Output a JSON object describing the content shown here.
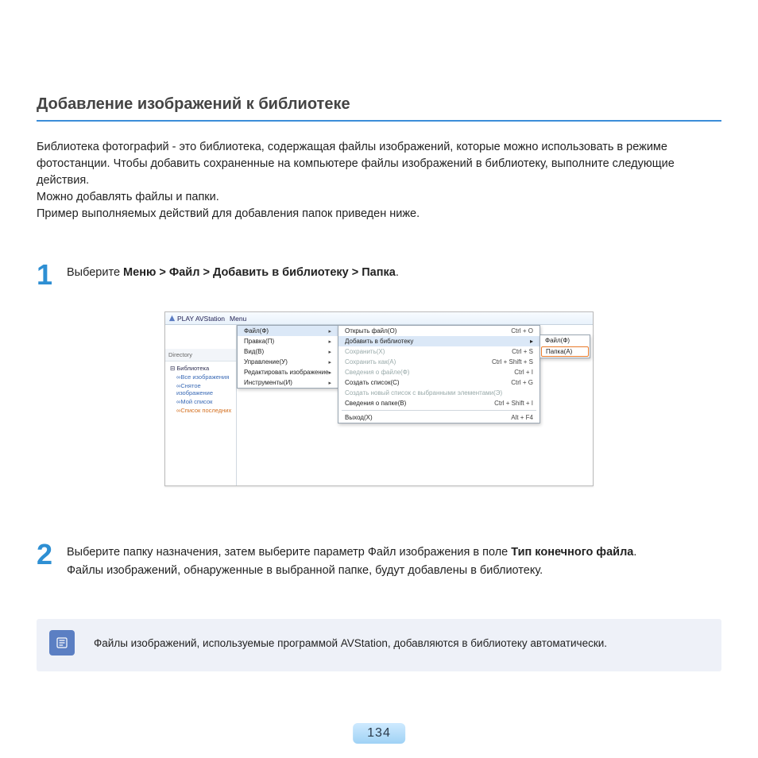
{
  "heading": "Добавление изображений к библиотеке",
  "intro": [
    "Библиотека фотографий - это библиотека, содержащая файлы изображений, которые можно использовать в режиме фотостанции. Чтобы добавить сохраненные на компьютере файлы изображений в библиотеку, выполните следующие действия.",
    "Можно добавлять файлы и папки.",
    "Пример выполняемых действий для добавления папок приведен ниже."
  ],
  "step1": {
    "num": "1",
    "prefix": "Выберите ",
    "bold": "Меню > Файл > Добавить в библиотеку > Папка",
    "suffix": "."
  },
  "screenshot": {
    "title": "PLAY AVStation",
    "menulabel": "Menu",
    "sidebar": {
      "dir": "Directory",
      "root": "Библиотека",
      "items": [
        "Все изображения",
        "Снятое изображение",
        "Мой список",
        "Список последних"
      ]
    },
    "menu1": [
      {
        "label": "Файл(Ф)",
        "arrow": true,
        "hl": false
      },
      {
        "label": "Правка(П)",
        "arrow": true,
        "hl": false
      },
      {
        "label": "Вид(В)",
        "arrow": true,
        "hl": false
      },
      {
        "label": "Управление(У)",
        "arrow": true,
        "hl": false
      },
      {
        "label": "Редактировать изображение",
        "arrow": true,
        "hl": false
      },
      {
        "label": "Инструменты(И)",
        "arrow": true,
        "hl": false
      }
    ],
    "submenu1": [
      {
        "label": "Открыть файл(O)",
        "shortcut": "Ctrl + O"
      },
      {
        "label": "Добавить в библиотеку",
        "arrow": true,
        "hl": true
      },
      {
        "label": "Сохранить(X)",
        "shortcut": "Ctrl + S",
        "disabled": true
      },
      {
        "label": "Сохранить как(A)",
        "shortcut": "Ctrl + Shift + S",
        "disabled": true
      },
      {
        "label": "Сведения о файле(Ф)",
        "shortcut": "Ctrl + I",
        "disabled": true
      },
      {
        "label": "Создать список(C)",
        "shortcut": "Ctrl + G"
      },
      {
        "label": "Создать новый список с выбранными элементами(Э)",
        "disabled": true
      },
      {
        "label": "Сведения о папке(В)",
        "shortcut": "Ctrl + Shift + I"
      },
      {
        "sep": true
      },
      {
        "label": "Выход(X)",
        "shortcut": "Alt + F4"
      }
    ],
    "submenu2": [
      {
        "label": "Файл(Ф)"
      },
      {
        "label": "Папка(A)",
        "boxed": true
      }
    ]
  },
  "step2": {
    "num": "2",
    "line1a": "Выберите папку назначения, затем выберите параметр Файл изображения в поле ",
    "line1b": "Тип конечного файла",
    "line1c": ".",
    "line2": "Файлы изображений, обнаруженные в выбранной папке, будут добавлены в библиотеку."
  },
  "note": "Файлы изображений, используемые программой AVStation, добавляются в библиотеку автоматически.",
  "pagenum": "134"
}
